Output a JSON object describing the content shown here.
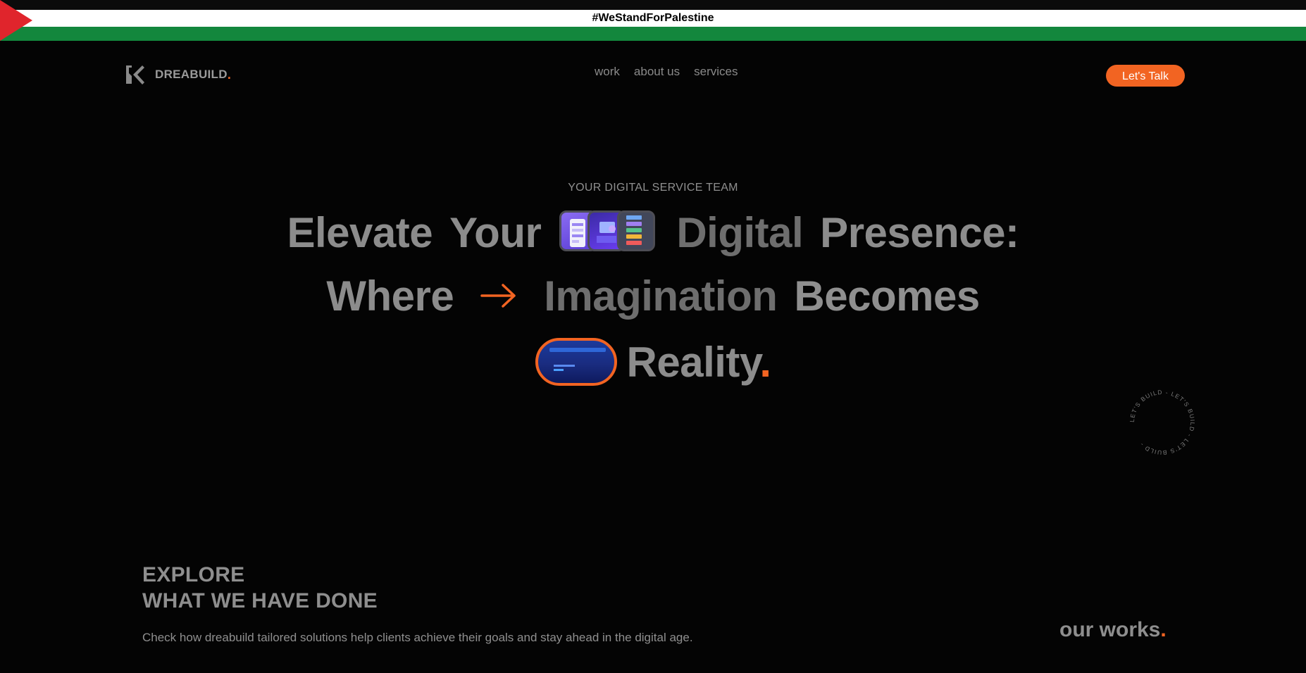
{
  "banner": {
    "hashtag": "#WeStandForPalestine",
    "colors": {
      "black": "#0b0b0b",
      "white": "#ffffff",
      "green": "#13873d",
      "red": "#e0252c"
    }
  },
  "header": {
    "logo_name": "DREABUILD",
    "logo_dot": ".",
    "logo_icon": "dreabuild-k-logo",
    "nav": [
      "work",
      "about us",
      "services"
    ],
    "cta_label": "Let's Talk"
  },
  "hero": {
    "eyebrow": "YOUR DIGITAL SERVICE TEAM",
    "line1": {
      "a": "Elevate",
      "b": "Your",
      "c": "Digital",
      "d": "Presence:"
    },
    "line2": {
      "a": "Where",
      "b": "Imagination",
      "c": "Becomes"
    },
    "line3": {
      "a": "Reality",
      "dot": "."
    },
    "arrow_icon": "arrow-right-icon",
    "rotating_badge": "LET'S BUILD - LET'S BUILD - LET'S BUILD - "
  },
  "explore": {
    "title_line1": "EXPLORE",
    "title_line2": "WHAT WE HAVE DONE",
    "description": "Check how dreabuild tailored solutions help clients achieve their goals and stay ahead in the digital age.",
    "our_works": "our works",
    "our_works_dot": "."
  },
  "theme": {
    "accent": "#f26422",
    "background": "#040404",
    "text": "#8c8c8c"
  }
}
